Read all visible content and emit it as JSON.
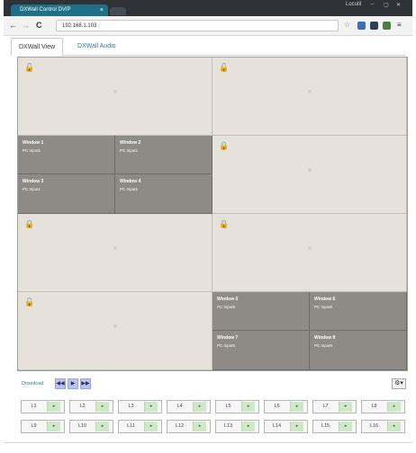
{
  "browser": {
    "tab_title": "DXWall Control DVIP",
    "tab_close": "×",
    "window_controls": [
      "Locutil",
      "–",
      "▢",
      "✕"
    ],
    "url": "192.168.1.103",
    "nav": {
      "back": "←",
      "forward": "→",
      "reload": "C"
    }
  },
  "app_tabs": [
    {
      "label": "DXWall View"
    },
    {
      "label": "DXWall Audio"
    }
  ],
  "wall": {
    "empty_lock_unlocked": "🔓",
    "empty_lock_locked": "🔒",
    "windows": [
      {
        "title": "Window 1",
        "source": "PC Input1"
      },
      {
        "title": "Window 2",
        "source": "PC Input1"
      },
      {
        "title": "Window 3",
        "source": "PC Input1"
      },
      {
        "title": "Window 4",
        "source": "PC Input1"
      },
      {
        "title": "Window 5",
        "source": "PC Input5"
      },
      {
        "title": "Window 6",
        "source": "PC Input6"
      },
      {
        "title": "Window 7",
        "source": "PC Input5"
      },
      {
        "title": "Window 8",
        "source": "PC Input6"
      }
    ]
  },
  "toolbar": {
    "label": "Download",
    "btn_rewind": "◀◀",
    "btn_play": "▶",
    "btn_forward": "▶▶",
    "gear": "⚙▾"
  },
  "layouts": {
    "row1": [
      "L1",
      "L2",
      "L3",
      "L4",
      "L5",
      "L6",
      "L7",
      "L8"
    ],
    "row2": [
      "L9",
      "L10",
      "L11",
      "L12",
      "L13",
      "L14",
      "L15",
      "L16"
    ],
    "arrow": "▸"
  }
}
